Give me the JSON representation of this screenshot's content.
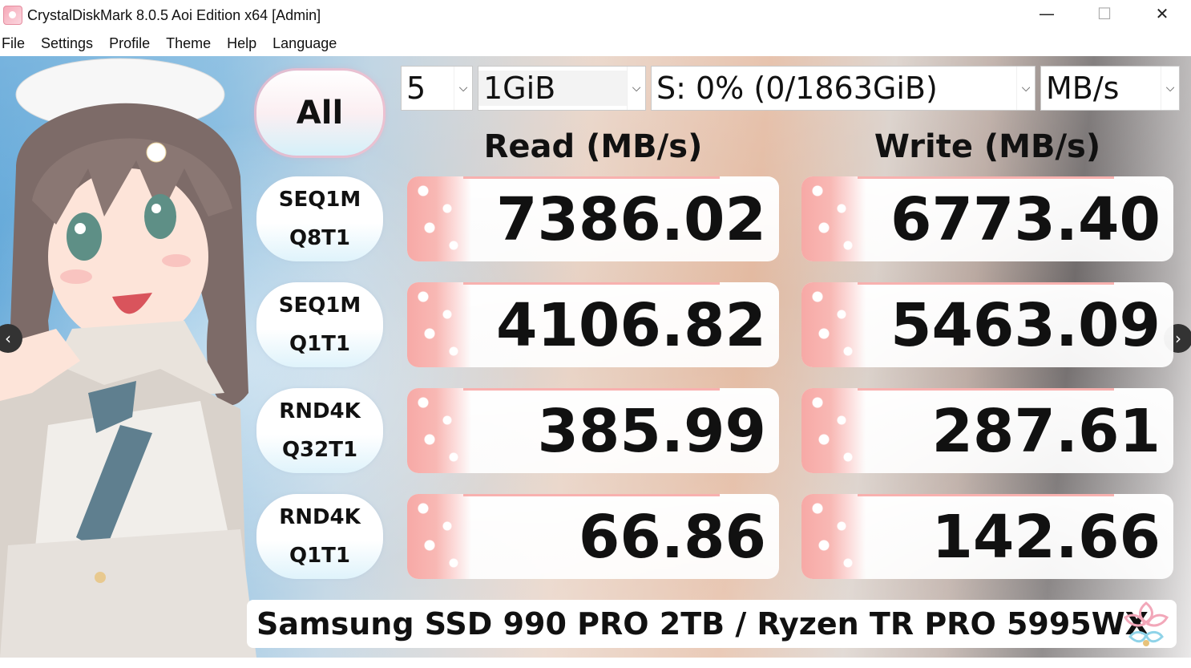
{
  "window": {
    "title": "CrystalDiskMark 8.0.5 Aoi Edition x64 [Admin]",
    "minimize_glyph": "—",
    "maximize_glyph": "☐",
    "close_glyph": "✕"
  },
  "menu": [
    "File",
    "Settings",
    "Profile",
    "Theme",
    "Help",
    "Language"
  ],
  "controls": {
    "all_button": "All",
    "count": "5",
    "size": "1GiB",
    "drive": "S: 0% (0/1863GiB)",
    "unit": "MB/s"
  },
  "headers": {
    "read": "Read (MB/s)",
    "write": "Write (MB/s)"
  },
  "tests": [
    {
      "line1": "SEQ1M",
      "line2": "Q8T1",
      "read": "7386.02",
      "write": "6773.40",
      "read_fill": 0.5,
      "write_fill": 0.5
    },
    {
      "line1": "SEQ1M",
      "line2": "Q1T1",
      "read": "4106.82",
      "write": "5463.09",
      "read_fill": 0.5,
      "write_fill": 0.5
    },
    {
      "line1": "RND4K",
      "line2": "Q32T1",
      "read": "385.99",
      "write": "287.61",
      "read_fill": 0.5,
      "write_fill": 0.5
    },
    {
      "line1": "RND4K",
      "line2": "Q1T1",
      "read": "66.86",
      "write": "142.66",
      "read_fill": 0.5,
      "write_fill": 0.5
    }
  ],
  "comment": "Samsung SSD 990 PRO 2TB / Ryzen TR PRO 5995WX",
  "nav": {
    "prev": "‹",
    "next": "›"
  },
  "icons": {
    "app": "crystaldiskmark-app-icon",
    "prev": "chevron-left-icon",
    "next": "chevron-right-icon",
    "dropdown": "chevron-down-icon",
    "logo": "sakura-logo-icon"
  },
  "colors": {
    "bar_pink": "#f7a9a6",
    "all_glow": "#ff8caa",
    "text": "#111111"
  }
}
